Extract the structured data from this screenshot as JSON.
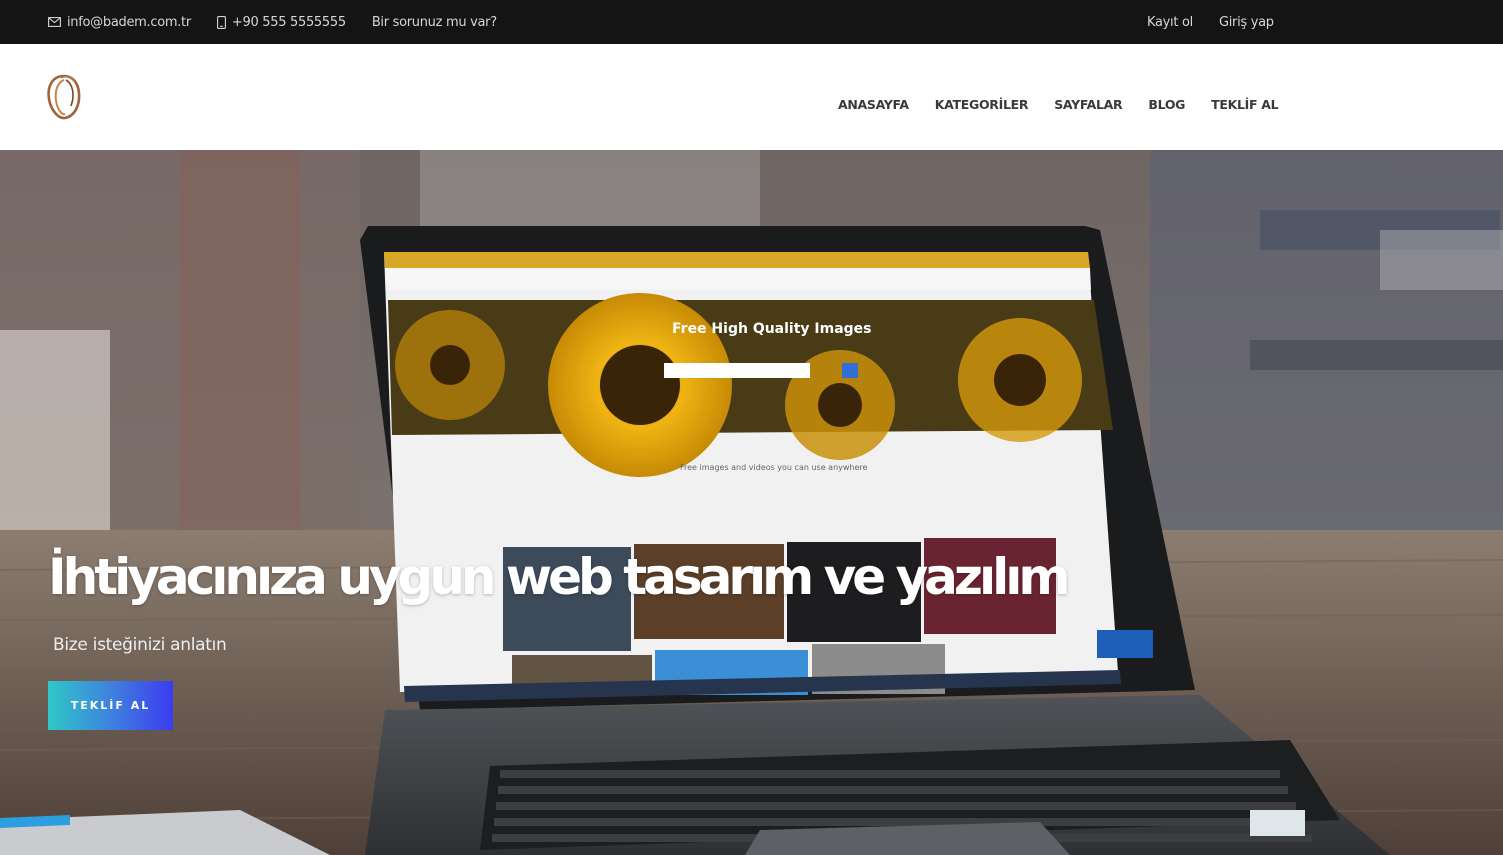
{
  "topbar": {
    "email": "info@badem.com.tr",
    "phone": "+90 555 5555555",
    "question": "Bir sorunuz mu var?",
    "register": "Kayıt ol",
    "login": "Giriş yap"
  },
  "nav": {
    "items": [
      "ANASAYFA",
      "KATEGORİLER",
      "SAYFALAR",
      "BLOG",
      "TEKLİF AL"
    ]
  },
  "hero": {
    "title": "İhtiyacınıza uygun web tasarım ve yazılım",
    "subtitle": "Bize isteğinizi anlatın",
    "button": "TEKLİF AL",
    "screen_heading": "Free High Quality Images",
    "screen_caption": "Free images and videos you can use anywhere"
  },
  "icons": {
    "email": "envelope-icon",
    "phone": "mobile-phone-icon",
    "logo": "badem-logo"
  },
  "colors": {
    "topbar_bg": "#141414",
    "nav_text": "#3a3a3a",
    "button_gradient_start": "#2fc8c8",
    "button_gradient_end": "#3b3bf0",
    "logo_brown": "#a0633a"
  }
}
